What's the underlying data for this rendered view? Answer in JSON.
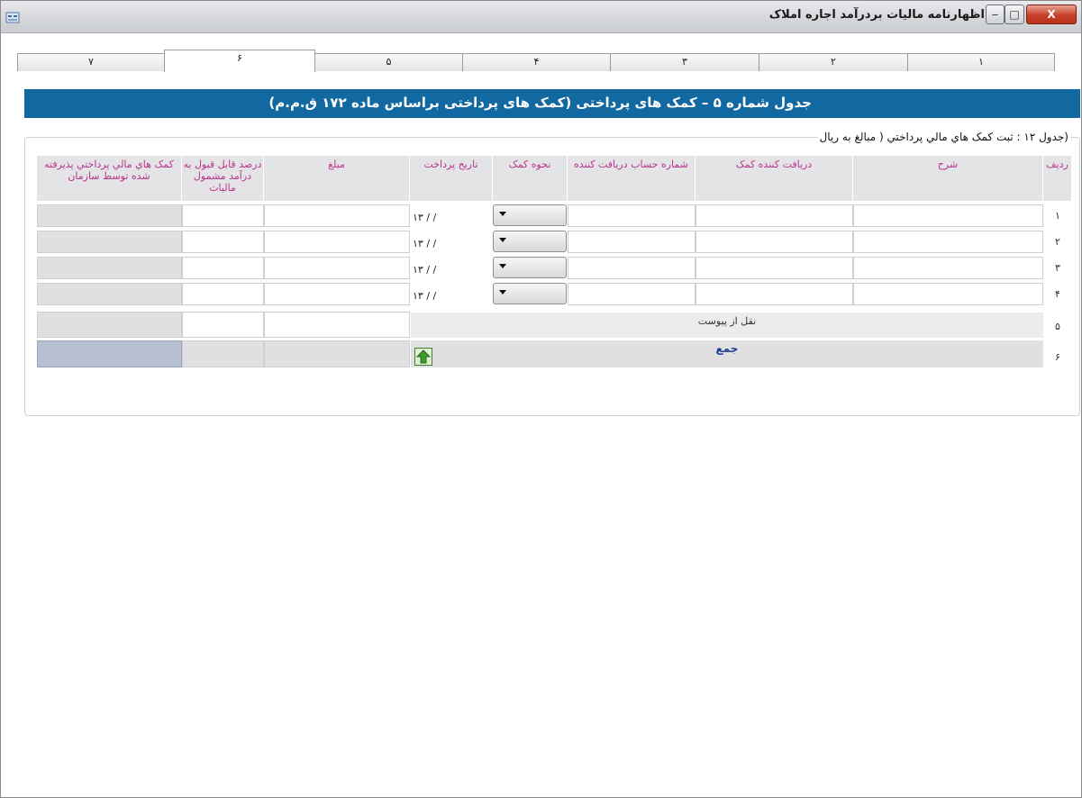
{
  "window": {
    "title": "اظهارنامه مالیات بردرآمد اجاره املاک",
    "min_label": "‒",
    "max_label": "□",
    "close_label": "X"
  },
  "tabs": [
    {
      "label": "۷",
      "active": false
    },
    {
      "label": "۶",
      "active": true
    },
    {
      "label": "۵",
      "active": false
    },
    {
      "label": "۴",
      "active": false
    },
    {
      "label": "۳",
      "active": false
    },
    {
      "label": "۲",
      "active": false
    },
    {
      "label": "۱",
      "active": false
    }
  ],
  "section_title": "جدول شماره ۵ – کمک های پرداختی (کمک های پرداختی براساس ماده ۱۷۲ ق.م.م)",
  "table_caption": "(جدول ۱۲ : ثبت کمک هاي مالي پرداختي ( مبالغ به ريال",
  "columns": {
    "row_no": "ردیف",
    "description": "شرح",
    "recipient": "دریافت کننده کمک",
    "account_no": "شماره حساب دریافت کننده",
    "aid_type": "نحوه کمک",
    "pay_date": "تاریخ پرداخت",
    "amount": "مبلغ",
    "percent": "درصد قابل قبول به درآمد مشمول مالیات",
    "accepted": "کمک هاي مالي پرداختي پذیرفته شده توسط سازمان"
  },
  "rows": [
    {
      "num": "۱",
      "date": "۱۳  /  /"
    },
    {
      "num": "۲",
      "date": "۱۳  /  /"
    },
    {
      "num": "۳",
      "date": "۱۳  /  /"
    },
    {
      "num": "۴",
      "date": "۱۳  /  /"
    }
  ],
  "row5": {
    "num": "۵",
    "label": "نقل از پیوست"
  },
  "row6": {
    "num": "۶",
    "label": "جمع"
  },
  "colors": {
    "band": "#1268a0",
    "header_text": "#b8338e",
    "total_text": "#1a3d8f"
  }
}
